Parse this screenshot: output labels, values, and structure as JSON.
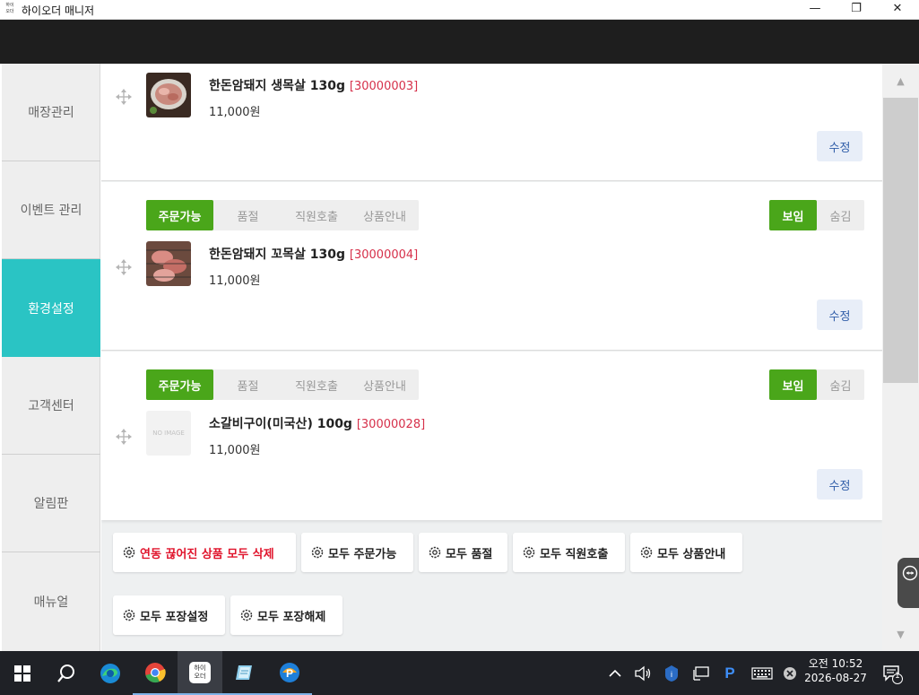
{
  "window": {
    "title": "하이오더 매니저",
    "app_icon_text": "하이\n오더",
    "minimize_glyph": "—",
    "restore_glyph": "❐",
    "close_glyph": "✕"
  },
  "sidebar": {
    "items": [
      {
        "label": "매장관리",
        "active": false
      },
      {
        "label": "이벤트 관리",
        "active": false
      },
      {
        "label": "환경설정",
        "active": true
      },
      {
        "label": "고객센터",
        "active": false
      },
      {
        "label": "알림판",
        "active": false
      },
      {
        "label": "매뉴얼",
        "active": false
      }
    ]
  },
  "products": [
    {
      "name": "한돈암돼지 생목살 130g",
      "code": "[30000003]",
      "price": "11,000원",
      "edit_label": "수정",
      "show_status": false
    },
    {
      "name": "한돈암돼지 꼬목살 130g",
      "code": "[30000004]",
      "price": "11,000원",
      "edit_label": "수정",
      "show_status": true,
      "status": [
        "주문가능",
        "품절",
        "직원호출",
        "상품안내"
      ],
      "status_selected": "주문가능",
      "visibility": [
        "보임",
        "숨김"
      ],
      "visibility_selected": "보임"
    },
    {
      "name": "소갈비구이(미국산) 100g",
      "code": "[30000028]",
      "price": "11,000원",
      "edit_label": "수정",
      "show_status": true,
      "status": [
        "주문가능",
        "품절",
        "직원호출",
        "상품안내"
      ],
      "status_selected": "주문가능",
      "visibility": [
        "보임",
        "숨김"
      ],
      "visibility_selected": "보임",
      "no_image_text": "NO IMAGE"
    }
  ],
  "bulk_actions": [
    {
      "label": "연동 끊어진 상품 모두 삭제",
      "danger": true
    },
    {
      "label": "모두 주문가능",
      "danger": false
    },
    {
      "label": "모두 품절",
      "danger": false
    },
    {
      "label": "모두 직원호출",
      "danger": false
    },
    {
      "label": "모두 상품안내",
      "danger": false
    },
    {
      "label": "모두 포장설정",
      "danger": false
    },
    {
      "label": "모두 포장해제",
      "danger": false
    }
  ],
  "taskbar": {
    "pinned_app_label": "하이\n오더",
    "clock_ampm_time": "오전 10:52",
    "clock_date": "2026-08-27",
    "notification_count": "1",
    "tray_p_label": "P"
  },
  "colors": {
    "accent_teal": "#2ac4c4",
    "status_green": "#4aa61a",
    "code_red": "#d6304a",
    "danger_red": "#e0142c",
    "edit_blue": "#2f5da8"
  }
}
